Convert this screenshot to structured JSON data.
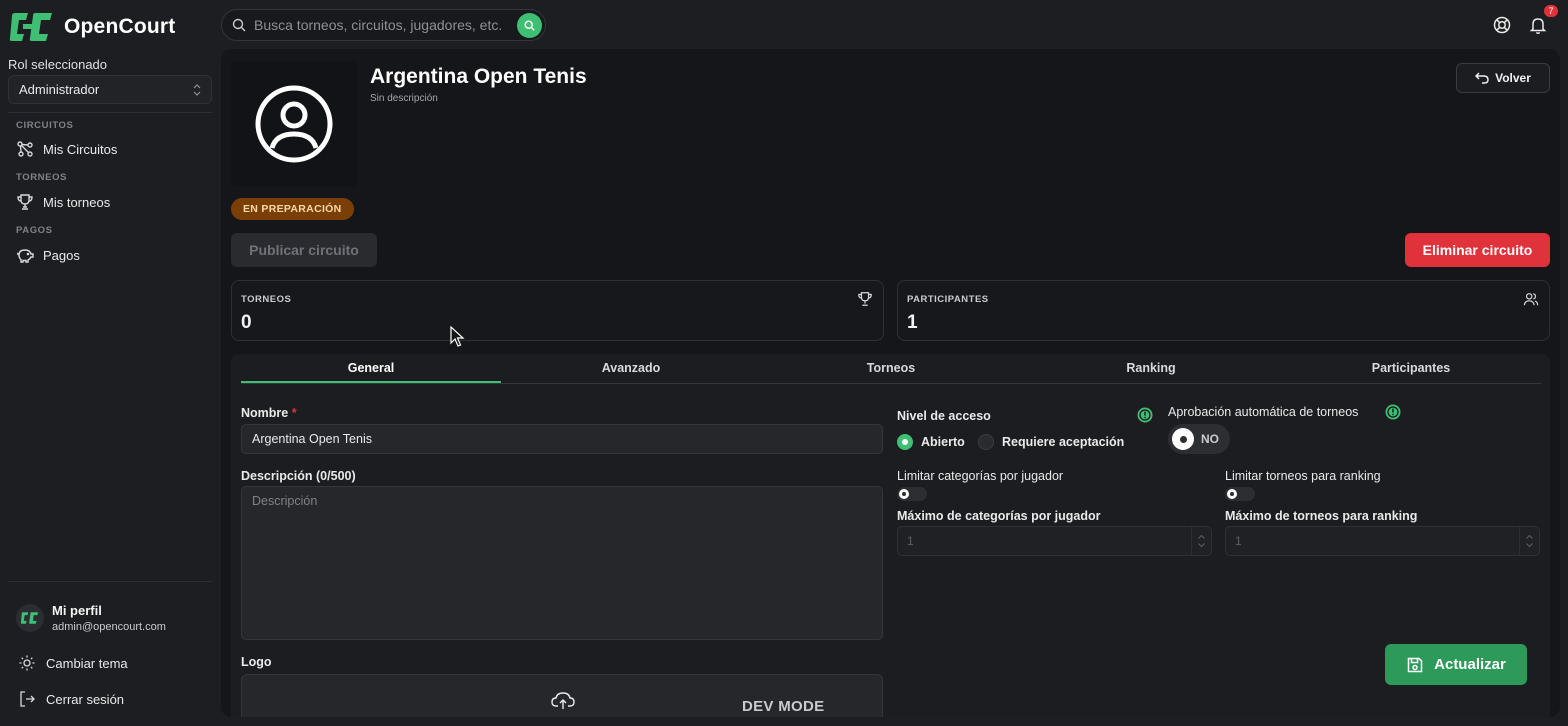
{
  "brand": {
    "name": "OpenCourt",
    "accent": "#3fbf73"
  },
  "sidebar": {
    "role_label": "Rol seleccionado",
    "role_value": "Administrador",
    "sections": [
      {
        "title": "CIRCUITOS",
        "item": "Mis Circuitos",
        "icon": "circuit-icon"
      },
      {
        "title": "TORNEOS",
        "item": "Mis torneos",
        "icon": "trophy-icon"
      },
      {
        "title": "PAGOS",
        "item": "Pagos",
        "icon": "piggy-bank-icon"
      }
    ],
    "profile": {
      "name": "Mi perfil",
      "email": "admin@opencourt.com"
    },
    "theme_label": "Cambiar tema",
    "logout_label": "Cerrar sesión"
  },
  "topbar": {
    "search_placeholder": "Busca torneos, circuitos, jugadores, etc.",
    "notifications_count": "7"
  },
  "header": {
    "title": "Argentina Open Tenis",
    "subtitle": "Sin descripción",
    "back_label": "Volver",
    "status": "EN PREPARACIÓN",
    "status_color": "#7a3f06",
    "publish_label": "Publicar circuito",
    "delete_label": "Eliminar circuito",
    "delete_color": "#e0323b"
  },
  "stats": [
    {
      "label": "TORNEOS",
      "value": "0",
      "icon": "trophy-icon"
    },
    {
      "label": "PARTICIPANTES",
      "value": "1",
      "icon": "users-icon"
    }
  ],
  "tabs": [
    "General",
    "Avanzado",
    "Torneos",
    "Ranking",
    "Participantes"
  ],
  "form": {
    "name_label": "Nombre",
    "name_required": "*",
    "name_value": "Argentina Open Tenis",
    "description_label": "Descripción (0/500)",
    "description_placeholder": "Descripción",
    "logo_label": "Logo",
    "access_label": "Nivel de acceso",
    "access_options": [
      "Abierto",
      "Requiere aceptación"
    ],
    "access_selected": "Abierto",
    "auto_approval_label": "Aprobación automática de torneos",
    "auto_approval_value": "NO",
    "limit_categories_label": "Limitar categorías por jugador",
    "limit_tournaments_label": "Limitar torneos para ranking",
    "max_categories_label": "Máximo de categorías por jugador",
    "max_categories_value": "1",
    "max_tournaments_label": "Máximo de torneos para ranking",
    "max_tournaments_value": "1",
    "update_label": "Actualizar",
    "dev_mode": "DEV MODE"
  }
}
